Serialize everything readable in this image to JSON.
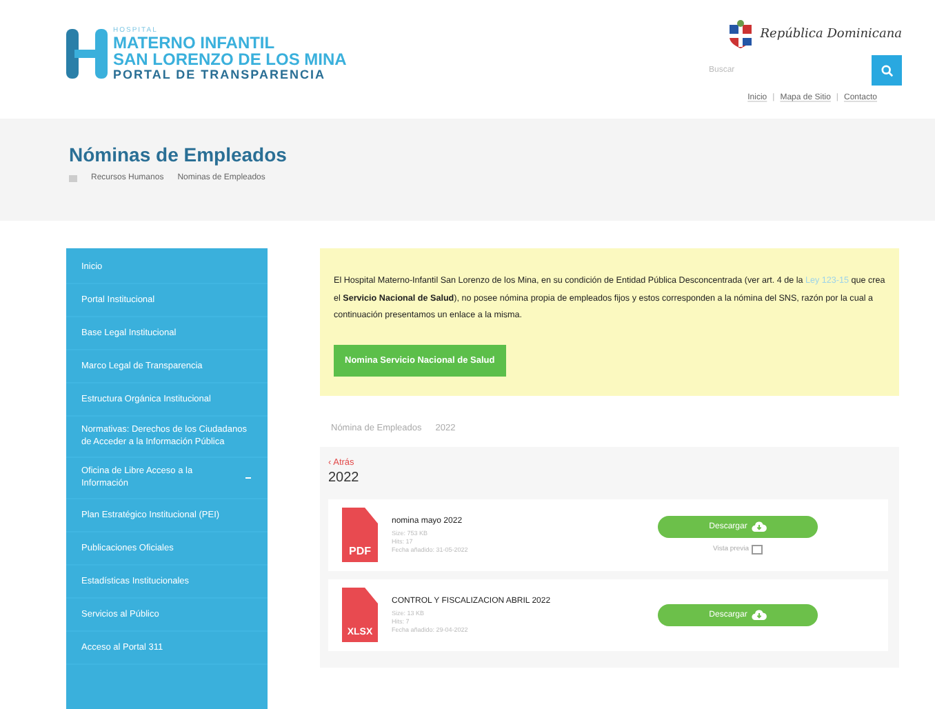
{
  "header": {
    "logo": {
      "overline": "HOSPITAL",
      "line1": "MATERNO INFANTIL",
      "line2": "SAN LORENZO DE LOS MINA",
      "line3": "PORTAL DE TRANSPARENCIA"
    },
    "country": "República Dominicana",
    "search": {
      "placeholder": "Buscar"
    },
    "top_links": [
      {
        "kind": "link",
        "text": "Inicio"
      },
      {
        "kind": "separator",
        "text": "|"
      },
      {
        "kind": "link",
        "text": "Mapa de Sitio"
      },
      {
        "kind": "separator",
        "text": "|"
      },
      {
        "kind": "link",
        "text": "Contacto"
      }
    ]
  },
  "page_title": "Nóminas de Empleados",
  "breadcrumb": [
    "Recursos Humanos",
    "Nominas de Empleados"
  ],
  "sidebar": {
    "items": [
      {
        "label": "Inicio",
        "has_submenu": false
      },
      {
        "label": "Portal Institucional",
        "has_submenu": false
      },
      {
        "label": "Base Legal Institucional",
        "has_submenu": false
      },
      {
        "label": "Marco Legal de Transparencia",
        "has_submenu": false
      },
      {
        "label": "Estructura Orgánica Institucional",
        "has_submenu": false
      },
      {
        "label": "Normativas: Derechos de los Ciudadanos de Acceder a la Información Pública",
        "has_submenu": false
      },
      {
        "label": "Oficina de Libre Acceso a la Información",
        "has_submenu": true
      },
      {
        "label": "Plan Estratégico Institucional (PEI)",
        "has_submenu": false
      },
      {
        "label": "Publicaciones Oficiales",
        "has_submenu": false
      },
      {
        "label": "Estadísticas Institucionales",
        "has_submenu": false
      },
      {
        "label": "Servicios al Público",
        "has_submenu": false
      },
      {
        "label": "Acceso al Portal 311",
        "has_submenu": false
      }
    ]
  },
  "notice": {
    "text_before": "El Hospital Materno-Infantil San Lorenzo de los Mina, en su condición de Entidad Pública Desconcentrada (ver art. 4 de la ",
    "link": "Ley 123-15",
    "text_after": " que crea el **Servicio Nacional de Salud**), no posee nómina propia de empleados fijos y estos corresponden a la nómina del SNS, razón por la cual a continuación presentamos un enlace a la misma.",
    "button": "Nomina Servicio Nacional de Salud"
  },
  "category_path": [
    "Nómina de Empleados",
    "2022"
  ],
  "back_link": "‹ Atrás",
  "year": "2022",
  "files": [
    {
      "kind": "pdf",
      "badge": "PDF",
      "title": "nomina mayo 2022",
      "meta": [
        "Size: 753 KB",
        "Hits: 17",
        "Fecha añadido: 31-05-2022"
      ],
      "button": "Descargar",
      "preview": "Vista previa"
    },
    {
      "kind": "xlsx",
      "badge": "XLSX",
      "title": "CONTROL Y FISCALIZACION ABRIL 2022",
      "meta": [
        "Size: 13 KB",
        "Hits: 7",
        "Fecha añadido: 29-04-2022"
      ],
      "button": "Descargar"
    }
  ]
}
